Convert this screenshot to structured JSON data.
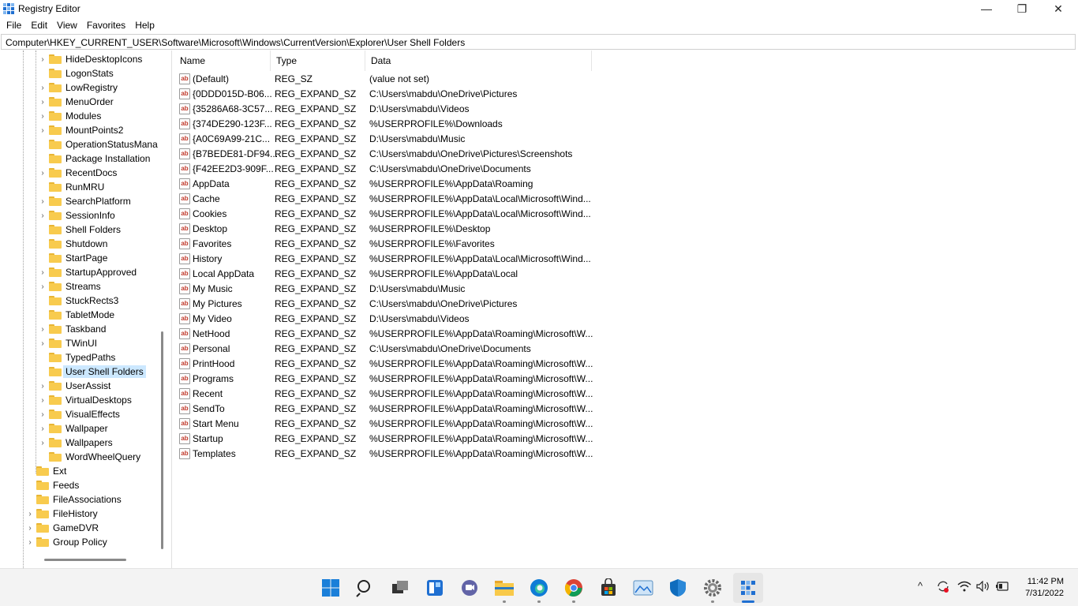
{
  "window": {
    "title": "Registry Editor",
    "minimize_glyph": "—",
    "maximize_glyph": "❐",
    "close_glyph": "✕"
  },
  "menu": [
    "File",
    "Edit",
    "View",
    "Favorites",
    "Help"
  ],
  "address": "Computer\\HKEY_CURRENT_USER\\Software\\Microsoft\\Windows\\CurrentVersion\\Explorer\\User Shell Folders",
  "tree": {
    "items": [
      {
        "label": "HideDesktopIcons",
        "expandable": true
      },
      {
        "label": "LogonStats",
        "expandable": false
      },
      {
        "label": "LowRegistry",
        "expandable": true
      },
      {
        "label": "MenuOrder",
        "expandable": true
      },
      {
        "label": "Modules",
        "expandable": true
      },
      {
        "label": "MountPoints2",
        "expandable": true
      },
      {
        "label": "OperationStatusMana",
        "expandable": false
      },
      {
        "label": "Package Installation",
        "expandable": false
      },
      {
        "label": "RecentDocs",
        "expandable": true
      },
      {
        "label": "RunMRU",
        "expandable": false
      },
      {
        "label": "SearchPlatform",
        "expandable": true
      },
      {
        "label": "SessionInfo",
        "expandable": true
      },
      {
        "label": "Shell Folders",
        "expandable": false
      },
      {
        "label": "Shutdown",
        "expandable": false
      },
      {
        "label": "StartPage",
        "expandable": false
      },
      {
        "label": "StartupApproved",
        "expandable": true
      },
      {
        "label": "Streams",
        "expandable": true
      },
      {
        "label": "StuckRects3",
        "expandable": false
      },
      {
        "label": "TabletMode",
        "expandable": false
      },
      {
        "label": "Taskband",
        "expandable": true
      },
      {
        "label": "TWinUI",
        "expandable": true
      },
      {
        "label": "TypedPaths",
        "expandable": false
      },
      {
        "label": "User Shell Folders",
        "expandable": false,
        "selected": true
      },
      {
        "label": "UserAssist",
        "expandable": true
      },
      {
        "label": "VirtualDesktops",
        "expandable": true
      },
      {
        "label": "VisualEffects",
        "expandable": true
      },
      {
        "label": "Wallpaper",
        "expandable": true
      },
      {
        "label": "Wallpapers",
        "expandable": true
      },
      {
        "label": "WordWheelQuery",
        "expandable": false
      }
    ],
    "parent_items": [
      {
        "label": "Ext",
        "expandable": false
      },
      {
        "label": "Feeds",
        "expandable": false
      },
      {
        "label": "FileAssociations",
        "expandable": false
      },
      {
        "label": "FileHistory",
        "expandable": true
      },
      {
        "label": "GameDVR",
        "expandable": true
      },
      {
        "label": "Group Policy",
        "expandable": true
      }
    ]
  },
  "list": {
    "columns": {
      "name": "Name",
      "type": "Type",
      "data": "Data"
    },
    "rows": [
      {
        "name": "(Default)",
        "type": "REG_SZ",
        "data": "(value not set)"
      },
      {
        "name": "{0DDD015D-B06...",
        "type": "REG_EXPAND_SZ",
        "data": "C:\\Users\\mabdu\\OneDrive\\Pictures"
      },
      {
        "name": "{35286A68-3C57...",
        "type": "REG_EXPAND_SZ",
        "data": "D:\\Users\\mabdu\\Videos"
      },
      {
        "name": "{374DE290-123F...",
        "type": "REG_EXPAND_SZ",
        "data": "%USERPROFILE%\\Downloads"
      },
      {
        "name": "{A0C69A99-21C...",
        "type": "REG_EXPAND_SZ",
        "data": "D:\\Users\\mabdu\\Music"
      },
      {
        "name": "{B7BEDE81-DF94...",
        "type": "REG_EXPAND_SZ",
        "data": "C:\\Users\\mabdu\\OneDrive\\Pictures\\Screenshots"
      },
      {
        "name": "{F42EE2D3-909F...",
        "type": "REG_EXPAND_SZ",
        "data": "C:\\Users\\mabdu\\OneDrive\\Documents"
      },
      {
        "name": "AppData",
        "type": "REG_EXPAND_SZ",
        "data": "%USERPROFILE%\\AppData\\Roaming"
      },
      {
        "name": "Cache",
        "type": "REG_EXPAND_SZ",
        "data": "%USERPROFILE%\\AppData\\Local\\Microsoft\\Wind..."
      },
      {
        "name": "Cookies",
        "type": "REG_EXPAND_SZ",
        "data": "%USERPROFILE%\\AppData\\Local\\Microsoft\\Wind..."
      },
      {
        "name": "Desktop",
        "type": "REG_EXPAND_SZ",
        "data": "%USERPROFILE%\\Desktop"
      },
      {
        "name": "Favorites",
        "type": "REG_EXPAND_SZ",
        "data": "%USERPROFILE%\\Favorites"
      },
      {
        "name": "History",
        "type": "REG_EXPAND_SZ",
        "data": "%USERPROFILE%\\AppData\\Local\\Microsoft\\Wind..."
      },
      {
        "name": "Local AppData",
        "type": "REG_EXPAND_SZ",
        "data": "%USERPROFILE%\\AppData\\Local"
      },
      {
        "name": "My Music",
        "type": "REG_EXPAND_SZ",
        "data": "D:\\Users\\mabdu\\Music"
      },
      {
        "name": "My Pictures",
        "type": "REG_EXPAND_SZ",
        "data": "C:\\Users\\mabdu\\OneDrive\\Pictures"
      },
      {
        "name": "My Video",
        "type": "REG_EXPAND_SZ",
        "data": "D:\\Users\\mabdu\\Videos"
      },
      {
        "name": "NetHood",
        "type": "REG_EXPAND_SZ",
        "data": "%USERPROFILE%\\AppData\\Roaming\\Microsoft\\W..."
      },
      {
        "name": "Personal",
        "type": "REG_EXPAND_SZ",
        "data": "C:\\Users\\mabdu\\OneDrive\\Documents"
      },
      {
        "name": "PrintHood",
        "type": "REG_EXPAND_SZ",
        "data": "%USERPROFILE%\\AppData\\Roaming\\Microsoft\\W..."
      },
      {
        "name": "Programs",
        "type": "REG_EXPAND_SZ",
        "data": "%USERPROFILE%\\AppData\\Roaming\\Microsoft\\W..."
      },
      {
        "name": "Recent",
        "type": "REG_EXPAND_SZ",
        "data": "%USERPROFILE%\\AppData\\Roaming\\Microsoft\\W..."
      },
      {
        "name": "SendTo",
        "type": "REG_EXPAND_SZ",
        "data": "%USERPROFILE%\\AppData\\Roaming\\Microsoft\\W..."
      },
      {
        "name": "Start Menu",
        "type": "REG_EXPAND_SZ",
        "data": "%USERPROFILE%\\AppData\\Roaming\\Microsoft\\W..."
      },
      {
        "name": "Startup",
        "type": "REG_EXPAND_SZ",
        "data": "%USERPROFILE%\\AppData\\Roaming\\Microsoft\\W..."
      },
      {
        "name": "Templates",
        "type": "REG_EXPAND_SZ",
        "data": "%USERPROFILE%\\AppData\\Roaming\\Microsoft\\W..."
      }
    ]
  },
  "taskbar": {
    "apps": [
      "windows-start-icon",
      "search-icon",
      "task-view-icon",
      "widgets-icon",
      "teams-chat-icon",
      "file-explorer-icon",
      "edge-icon",
      "chrome-icon",
      "store-icon",
      "photos-icon",
      "defender-icon",
      "settings-icon",
      "regedit-icon"
    ],
    "clock_time": "11:42 PM",
    "clock_date": "7/31/2022"
  }
}
